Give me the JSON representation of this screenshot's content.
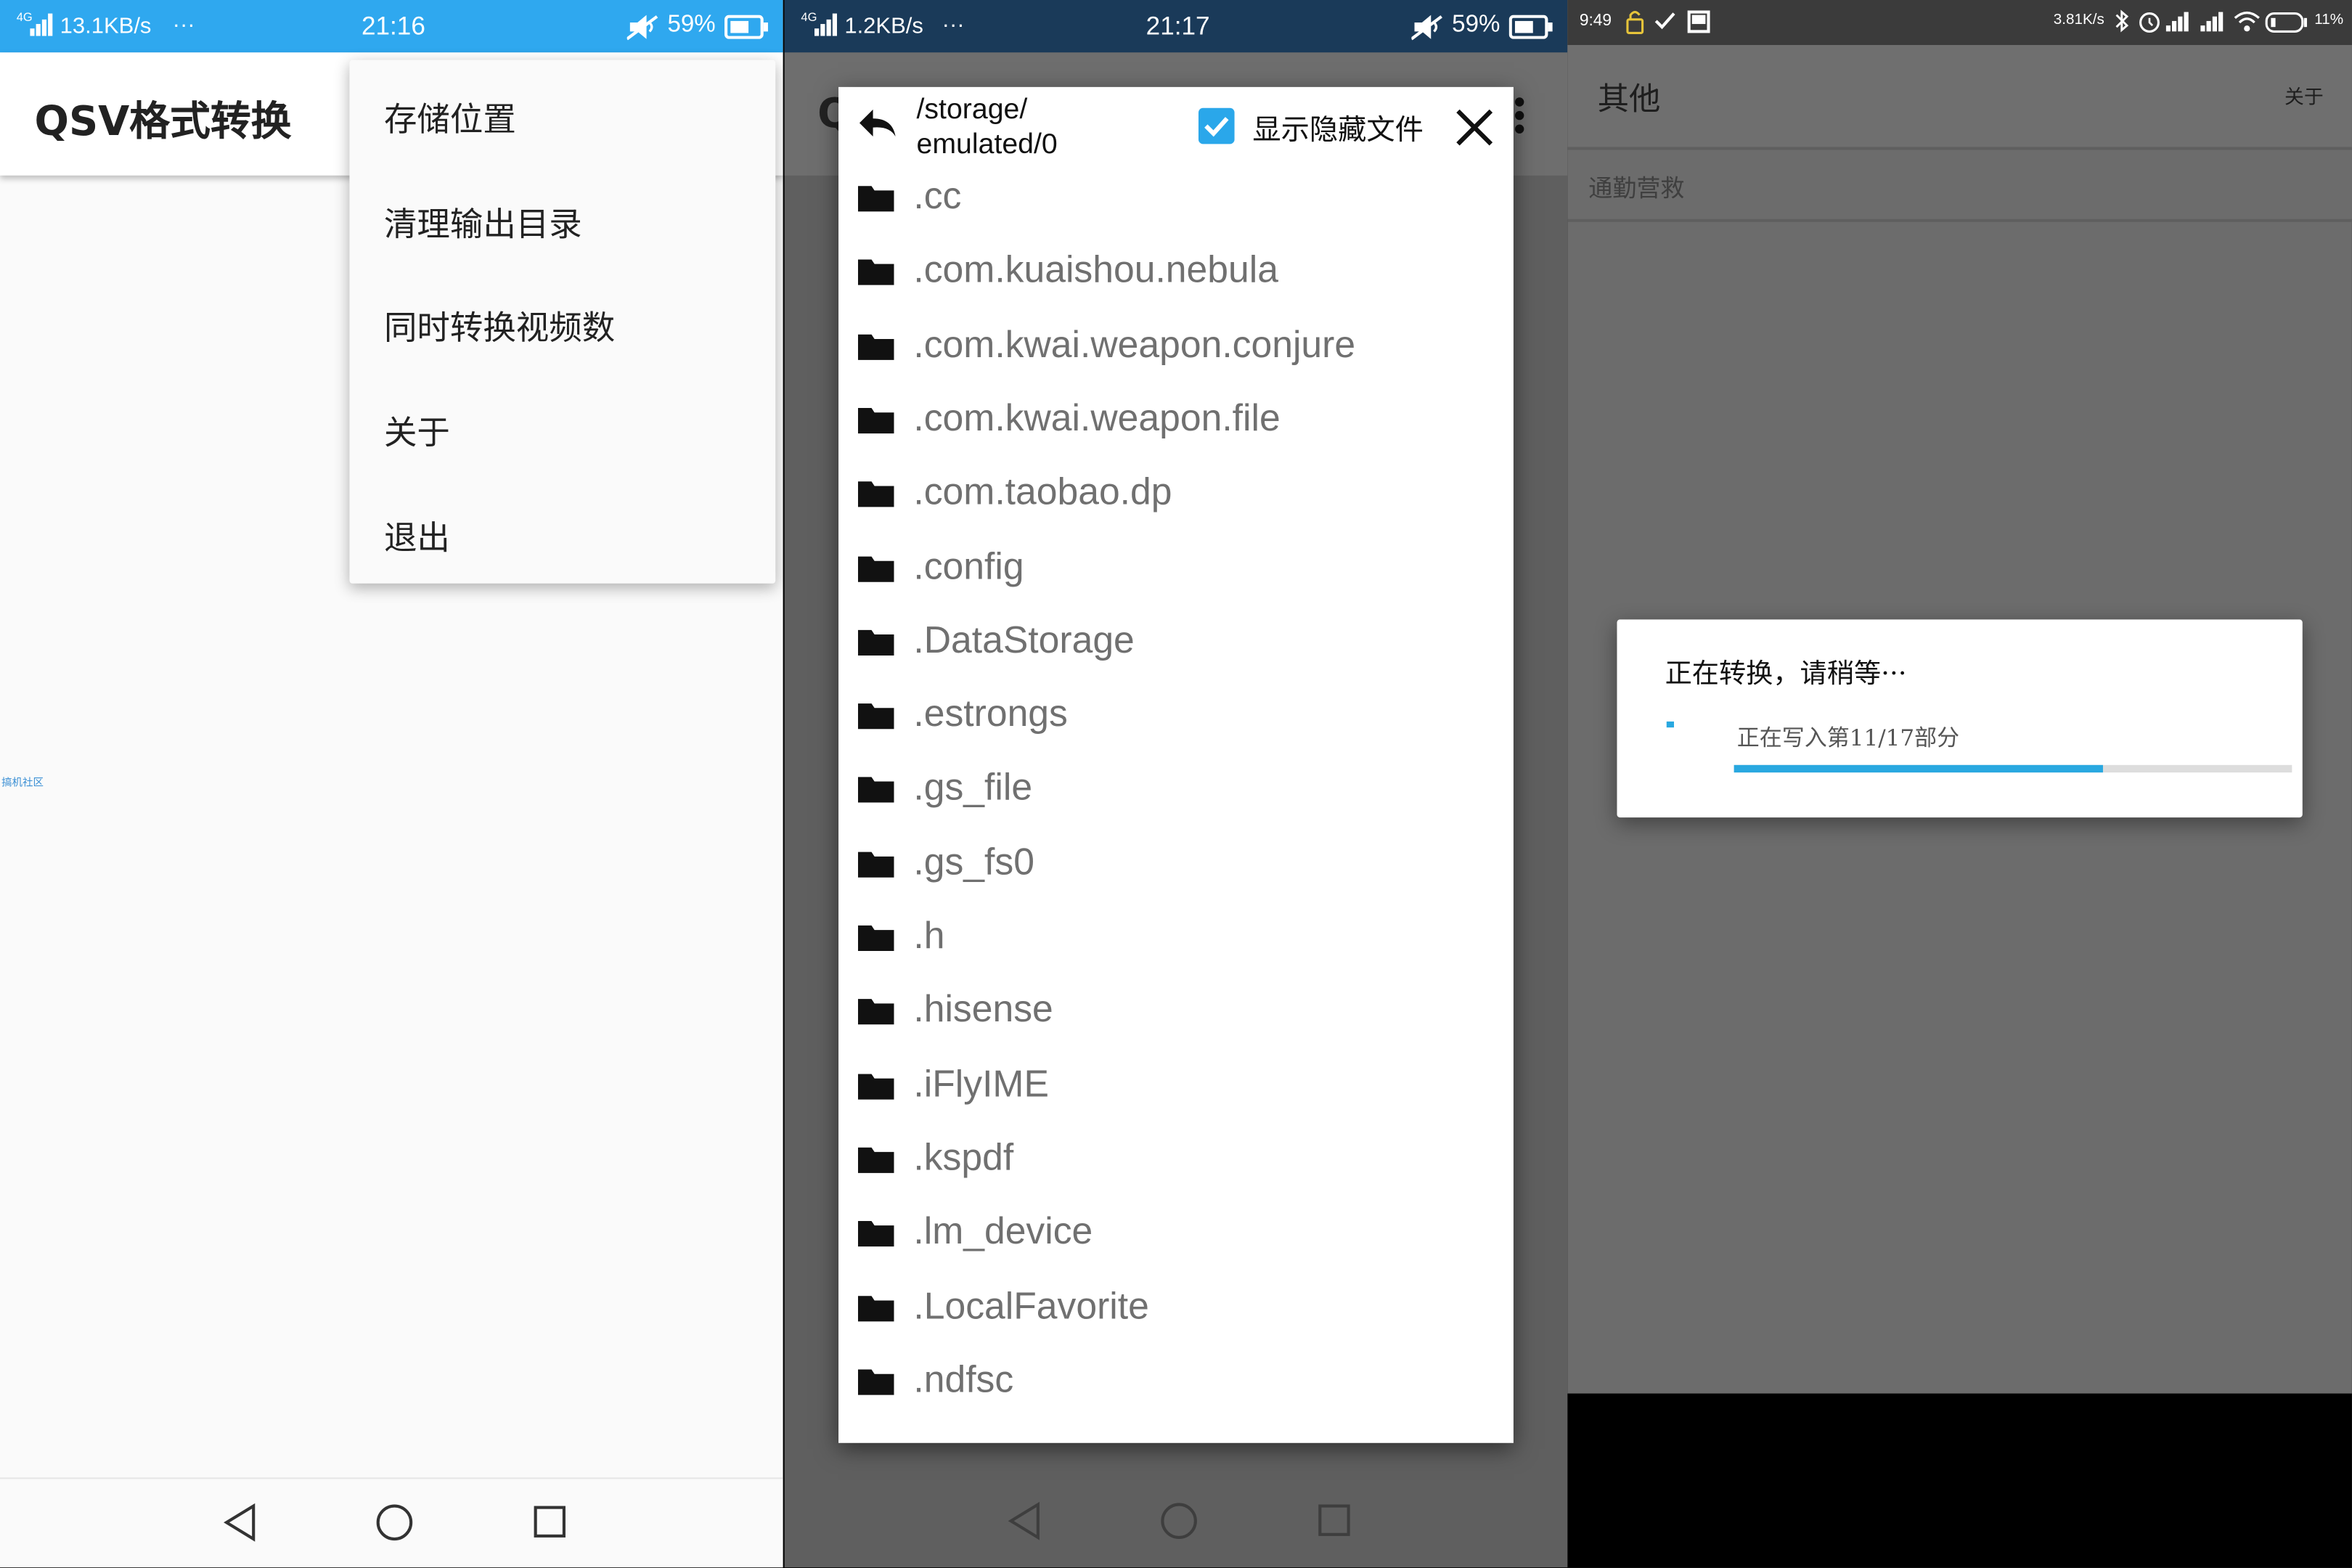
{
  "screen1": {
    "status": {
      "network_type": "4G",
      "speed": "13.1KB/s",
      "more": "···",
      "time": "21:16",
      "battery": "59%"
    },
    "app_title": "QSV格式转换",
    "menu": {
      "items": [
        "存储位置",
        "清理输出目录",
        "同时转换视频数",
        "关于",
        "退出"
      ]
    },
    "watermark": "搞机社区"
  },
  "screen2": {
    "status": {
      "network_type": "4G",
      "speed": "1.2KB/s",
      "more": "···",
      "time": "21:17",
      "battery": "59%"
    },
    "app_title_partial": "Q",
    "dialog": {
      "path": [
        "/storage/",
        "emulated/0"
      ],
      "show_hidden_label": "显示隐藏文件",
      "show_hidden_checked": true,
      "files": [
        ".cc",
        ".com.kuaishou.nebula",
        ".com.kwai.weapon.conjure",
        ".com.kwai.weapon.file",
        ".com.taobao.dp",
        ".config",
        ".DataStorage",
        ".estrongs",
        ".gs_file",
        ".gs_fs0",
        ".h",
        ".hisense",
        ".iFlyIME",
        ".kspdf",
        ".lm_device",
        ".LocalFavorite",
        ".ndfsc"
      ]
    }
  },
  "screen3": {
    "status": {
      "time": "9:49",
      "speed": "3.81K/s",
      "battery": "11%"
    },
    "title": "其他",
    "about": "关于",
    "list_item": "通勤营救",
    "progress_dialog": {
      "title": "正在转换，请稍等···",
      "message": "正在写入第11/17部分",
      "progress": 0.66
    }
  },
  "colors": {
    "accent": "#2fa8ef",
    "checkbox": "#2aa7ea",
    "progress_fill": "#29a8e0",
    "progress_track": "#dddddd"
  }
}
